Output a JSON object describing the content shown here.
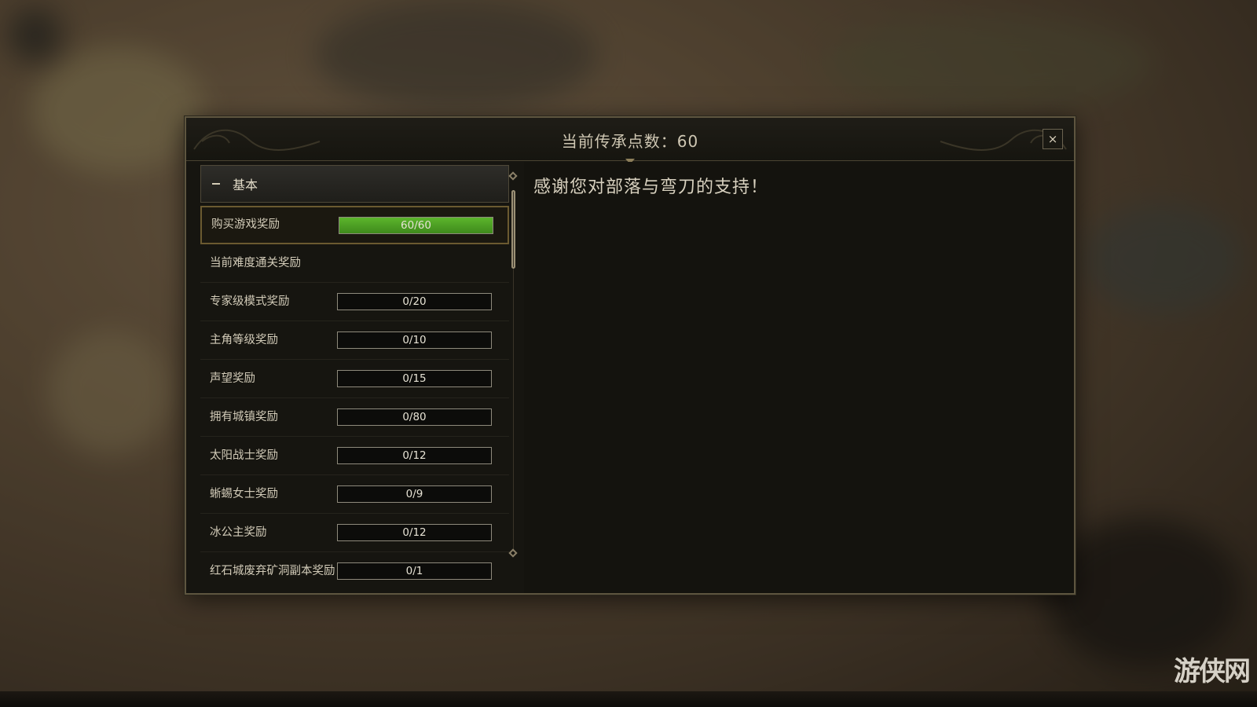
{
  "dialog": {
    "title": "当前传承点数：60",
    "close_label": "×"
  },
  "category": {
    "label": "基本"
  },
  "rows": [
    {
      "label": "购买游戏奖励",
      "progress": "60/60",
      "fill": 1.0,
      "active": true
    },
    {
      "label": "当前难度通关奖励",
      "progress": null,
      "fill": 0
    },
    {
      "label": "专家级模式奖励",
      "progress": "0/20",
      "fill": 0
    },
    {
      "label": "主角等级奖励",
      "progress": "0/10",
      "fill": 0
    },
    {
      "label": "声望奖励",
      "progress": "0/15",
      "fill": 0
    },
    {
      "label": "拥有城镇奖励",
      "progress": "0/80",
      "fill": 0
    },
    {
      "label": "太阳战士奖励",
      "progress": "0/12",
      "fill": 0
    },
    {
      "label": "蜥蜴女士奖励",
      "progress": "0/9",
      "fill": 0
    },
    {
      "label": "冰公主奖励",
      "progress": "0/12",
      "fill": 0
    },
    {
      "label": "红石城废弃矿洞副本奖励",
      "progress": "0/1",
      "fill": 0
    }
  ],
  "detail": {
    "message": "感谢您对部落与弯刀的支持！"
  },
  "watermark": "游侠网",
  "colors": {
    "progress_fill": "#4fa224",
    "accent_border": "#6b5a30"
  }
}
